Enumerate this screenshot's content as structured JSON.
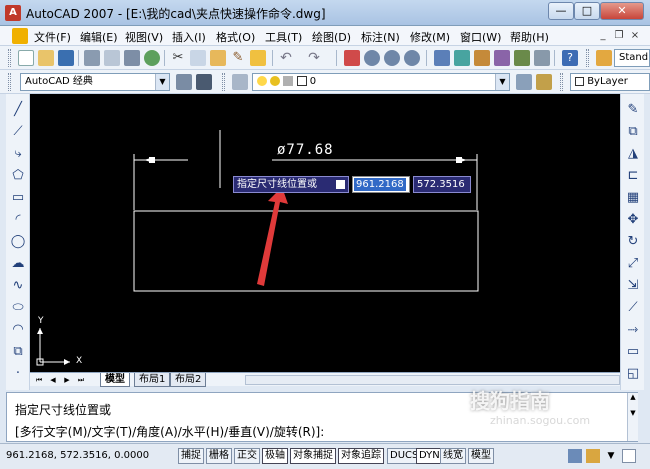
{
  "window": {
    "title": "AutoCAD 2007 - [E:\\我的cad\\夹点快速操作命令.dwg]",
    "min_label": "—",
    "max_label": "□",
    "close_label": "✕"
  },
  "menu": {
    "items": [
      "文件(F)",
      "编辑(E)",
      "视图(V)",
      "插入(I)",
      "格式(O)",
      "工具(T)",
      "绘图(D)",
      "标注(N)",
      "修改(M)",
      "窗口(W)",
      "帮助(H)"
    ],
    "mdi_min": "_",
    "mdi_restore": "❐",
    "mdi_close": "×"
  },
  "toolbar": {
    "workspace_value": "AutoCAD 经典",
    "layer_value": "0",
    "color_value": "ByLayer",
    "textstyle_value": "Stand"
  },
  "drawing": {
    "dimension_text": "ø77.68",
    "ucs_x": "X",
    "ucs_y": "Y"
  },
  "dynamic_input": {
    "prompt": "指定尺寸线位置或",
    "x_value": "961.2168",
    "y_value": "572.3516"
  },
  "layout_tabs": {
    "items": [
      "模型",
      "布局1",
      "布局2"
    ],
    "active": "模型"
  },
  "command": {
    "line1": "指定尺寸线位置或",
    "line2": "[多行文字(M)/文字(T)/角度(A)/水平(H)/垂直(V)/旋转(R)]:"
  },
  "status": {
    "coordinates": "961.2168,  572.3516, 0.0000",
    "buttons": [
      "捕捉",
      "栅格",
      "正交",
      "极轴",
      "对象捕捉",
      "对象追踪",
      "DUCS",
      "DYN",
      "线宽",
      "模型"
    ]
  },
  "watermark": {
    "text": "搜狗指南",
    "sub": "zhinan.sogou.com"
  },
  "colors": {
    "canvas": "#000000",
    "drawing_lines": "#ffffff",
    "dynamic_input_bg": "#2a2b73",
    "annotation_arrow": "#e03a3a",
    "chrome": "#dfe8f3"
  }
}
